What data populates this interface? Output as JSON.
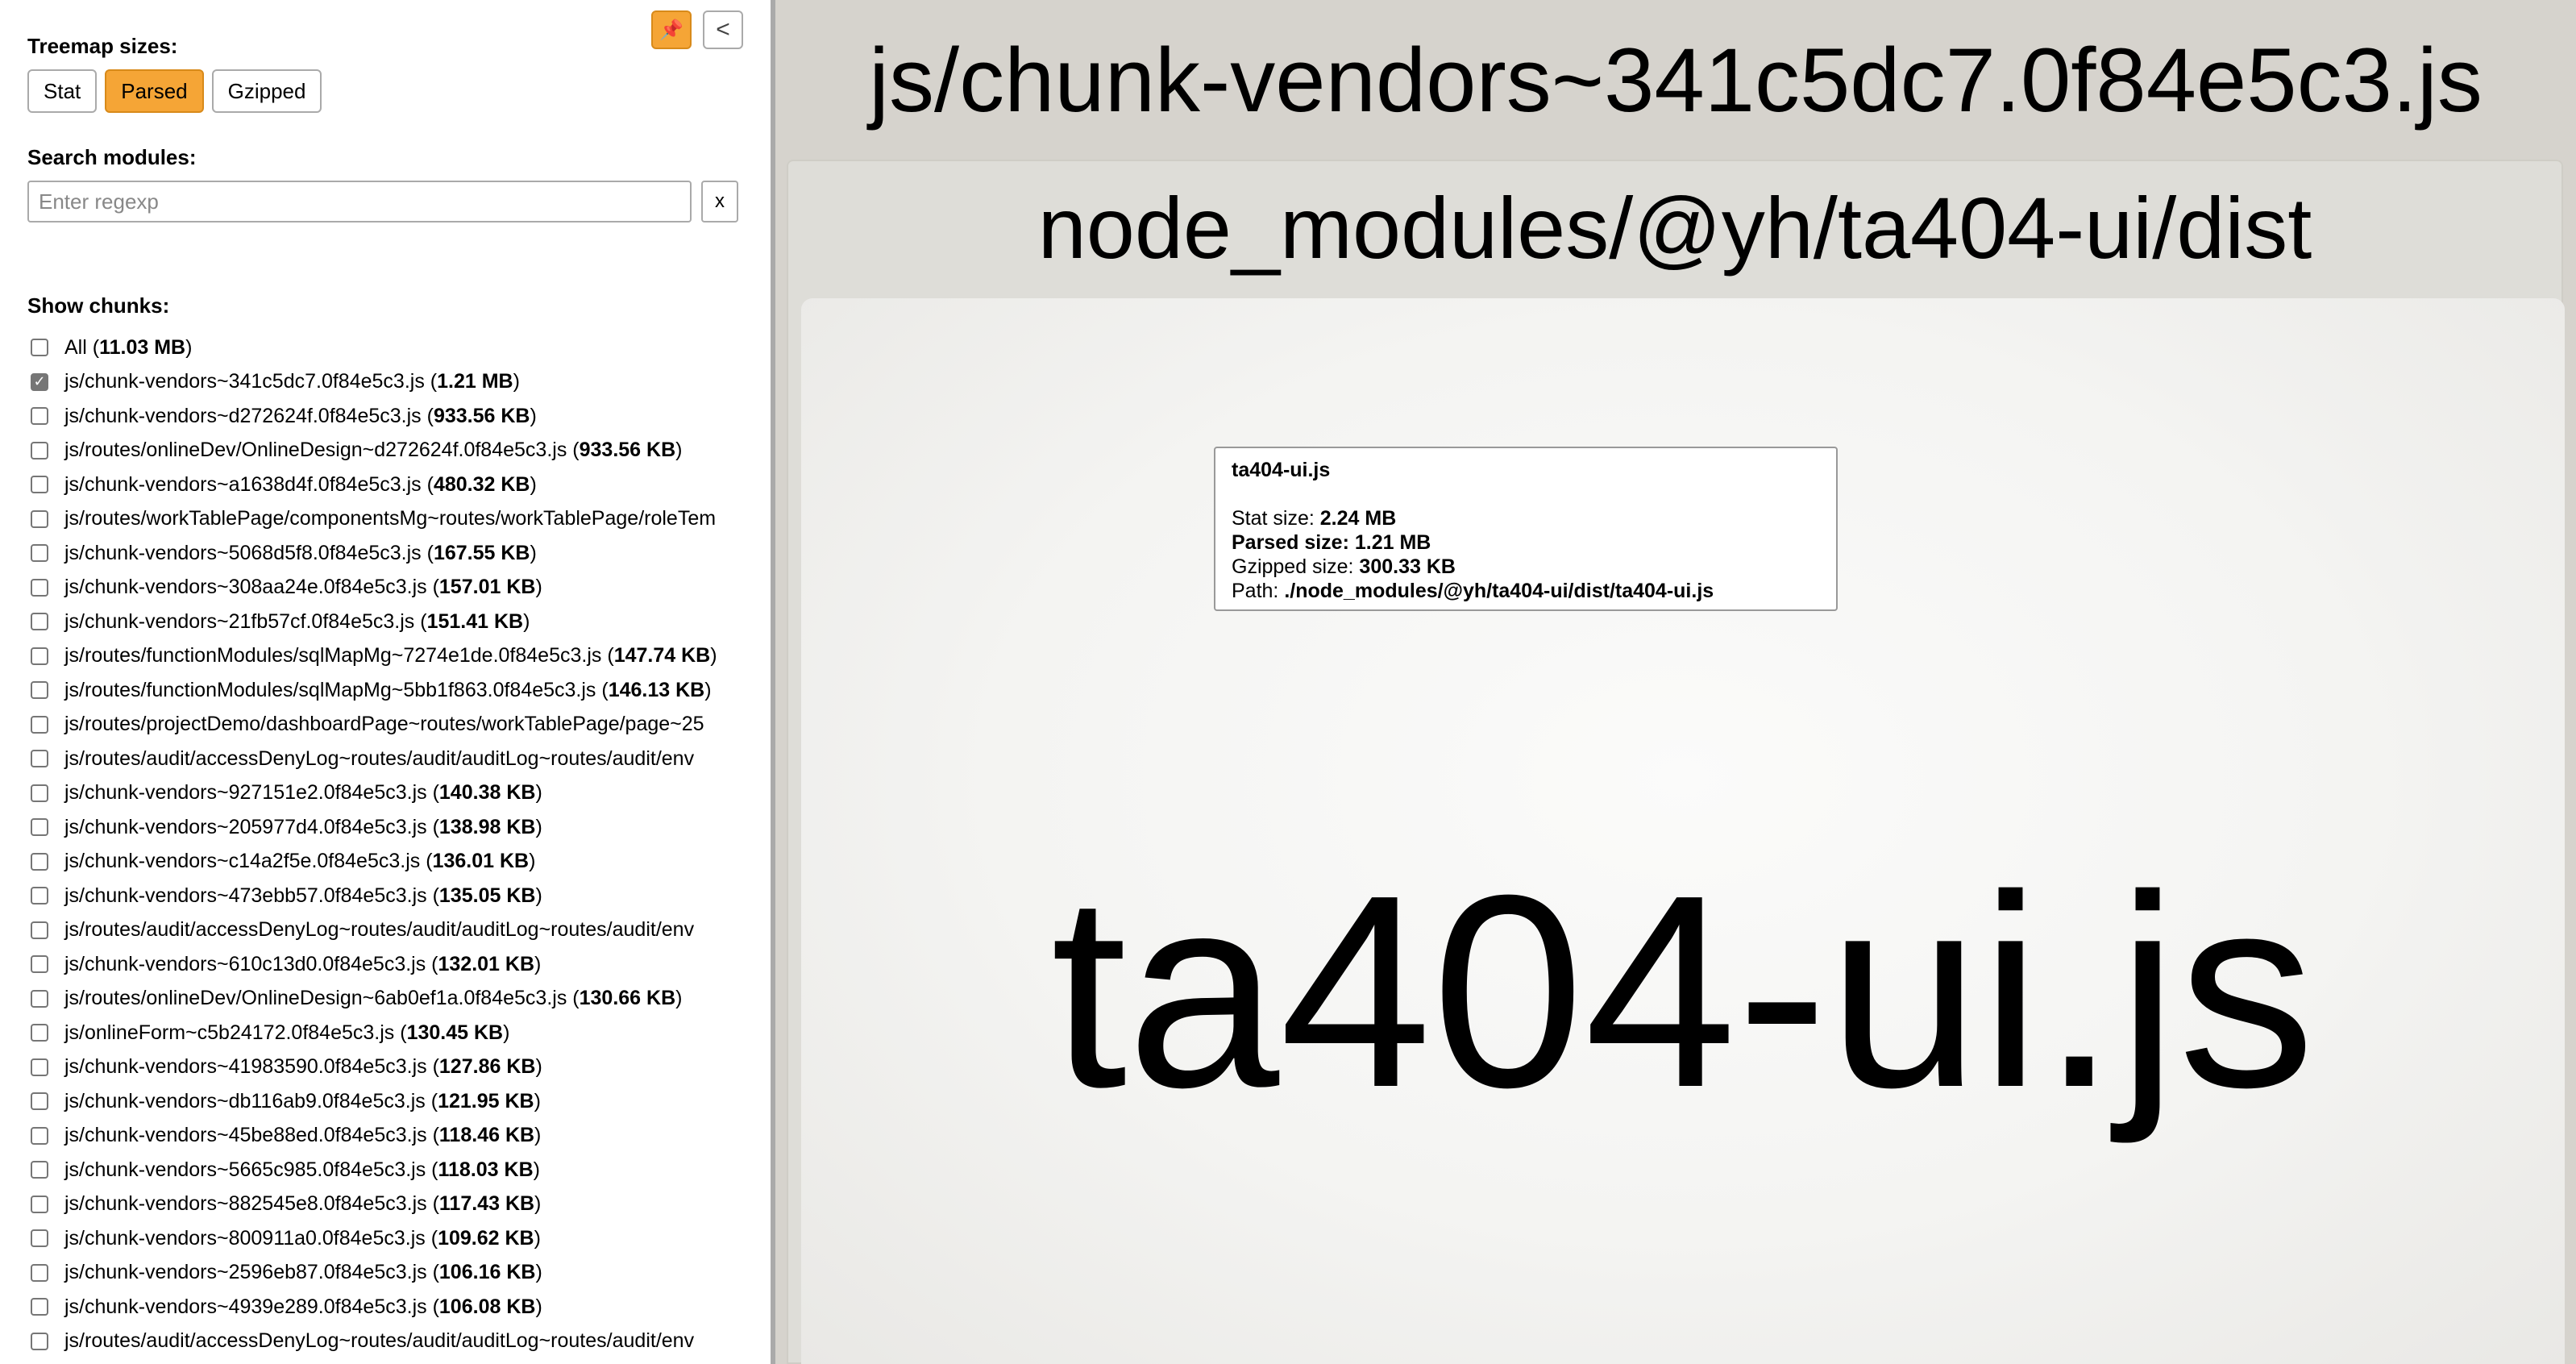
{
  "sidebar": {
    "treemap_sizes_label": "Treemap sizes:",
    "size_buttons": [
      "Stat",
      "Parsed",
      "Gzipped"
    ],
    "active_size": "Parsed",
    "pin_icon": "pin-icon",
    "collapse_icon": "chevron-left-icon",
    "pin_glyph": "📌",
    "collapse_glyph": "<",
    "search_label": "Search modules:",
    "search_placeholder": "Enter regexp",
    "search_value": "",
    "clear_label": "x",
    "show_chunks_label": "Show chunks:",
    "chunks": [
      {
        "name": "All",
        "size": "11.03 MB",
        "checked": false
      },
      {
        "name": "js/chunk-vendors~341c5dc7.0f84e5c3.js",
        "size": "1.21 MB",
        "checked": true
      },
      {
        "name": "js/chunk-vendors~d272624f.0f84e5c3.js",
        "size": "933.56 KB",
        "checked": false
      },
      {
        "name": "js/routes/onlineDev/OnlineDesign~d272624f.0f84e5c3.js",
        "size": "933.56 KB",
        "checked": false
      },
      {
        "name": "js/chunk-vendors~a1638d4f.0f84e5c3.js",
        "size": "480.32 KB",
        "checked": false
      },
      {
        "name": "js/routes/workTablePage/componentsMg~routes/workTablePage/roleTem",
        "size": "",
        "checked": false
      },
      {
        "name": "js/chunk-vendors~5068d5f8.0f84e5c3.js",
        "size": "167.55 KB",
        "checked": false
      },
      {
        "name": "js/chunk-vendors~308aa24e.0f84e5c3.js",
        "size": "157.01 KB",
        "checked": false
      },
      {
        "name": "js/chunk-vendors~21fb57cf.0f84e5c3.js",
        "size": "151.41 KB",
        "checked": false
      },
      {
        "name": "js/routes/functionModules/sqlMapMg~7274e1de.0f84e5c3.js",
        "size": "147.74 KB",
        "checked": false
      },
      {
        "name": "js/routes/functionModules/sqlMapMg~5bb1f863.0f84e5c3.js",
        "size": "146.13 KB",
        "checked": false
      },
      {
        "name": "js/routes/projectDemo/dashboardPage~routes/workTablePage/page~25",
        "size": "",
        "checked": false
      },
      {
        "name": "js/routes/audit/accessDenyLog~routes/audit/auditLog~routes/audit/env",
        "size": "",
        "checked": false
      },
      {
        "name": "js/chunk-vendors~927151e2.0f84e5c3.js",
        "size": "140.38 KB",
        "checked": false
      },
      {
        "name": "js/chunk-vendors~205977d4.0f84e5c3.js",
        "size": "138.98 KB",
        "checked": false
      },
      {
        "name": "js/chunk-vendors~c14a2f5e.0f84e5c3.js",
        "size": "136.01 KB",
        "checked": false
      },
      {
        "name": "js/chunk-vendors~473ebb57.0f84e5c3.js",
        "size": "135.05 KB",
        "checked": false
      },
      {
        "name": "js/routes/audit/accessDenyLog~routes/audit/auditLog~routes/audit/env",
        "size": "",
        "checked": false
      },
      {
        "name": "js/chunk-vendors~610c13d0.0f84e5c3.js",
        "size": "132.01 KB",
        "checked": false
      },
      {
        "name": "js/routes/onlineDev/OnlineDesign~6ab0ef1a.0f84e5c3.js",
        "size": "130.66 KB",
        "checked": false
      },
      {
        "name": "js/onlineForm~c5b24172.0f84e5c3.js",
        "size": "130.45 KB",
        "checked": false
      },
      {
        "name": "js/chunk-vendors~41983590.0f84e5c3.js",
        "size": "127.86 KB",
        "checked": false
      },
      {
        "name": "js/chunk-vendors~db116ab9.0f84e5c3.js",
        "size": "121.95 KB",
        "checked": false
      },
      {
        "name": "js/chunk-vendors~45be88ed.0f84e5c3.js",
        "size": "118.46 KB",
        "checked": false
      },
      {
        "name": "js/chunk-vendors~5665c985.0f84e5c3.js",
        "size": "118.03 KB",
        "checked": false
      },
      {
        "name": "js/chunk-vendors~882545e8.0f84e5c3.js",
        "size": "117.43 KB",
        "checked": false
      },
      {
        "name": "js/chunk-vendors~800911a0.0f84e5c3.js",
        "size": "109.62 KB",
        "checked": false
      },
      {
        "name": "js/chunk-vendors~2596eb87.0f84e5c3.js",
        "size": "106.16 KB",
        "checked": false
      },
      {
        "name": "js/chunk-vendors~4939e289.0f84e5c3.js",
        "size": "106.08 KB",
        "checked": false
      },
      {
        "name": "js/routes/audit/accessDenyLog~routes/audit/auditLog~routes/audit/env",
        "size": "",
        "checked": false
      }
    ]
  },
  "treemap": {
    "chunk_title": "js/chunk-vendors~341c5dc7.0f84e5c3.js",
    "module_title": "node_modules/@yh/ta404-ui/dist",
    "file_title": "ta404-ui.js"
  },
  "tooltip": {
    "name": "ta404-ui.js",
    "stat_label": "Stat size:",
    "stat_value": "2.24 MB",
    "parsed_label": "Parsed size:",
    "parsed_value": "1.21 MB",
    "gzipped_label": "Gzipped size:",
    "gzipped_value": "300.33 KB",
    "path_label": "Path:",
    "path_value": "./node_modules/@yh/ta404-ui/dist/ta404-ui.js"
  },
  "colors": {
    "accent": "#f5a536",
    "treemap_background": "#d6d3cd"
  }
}
